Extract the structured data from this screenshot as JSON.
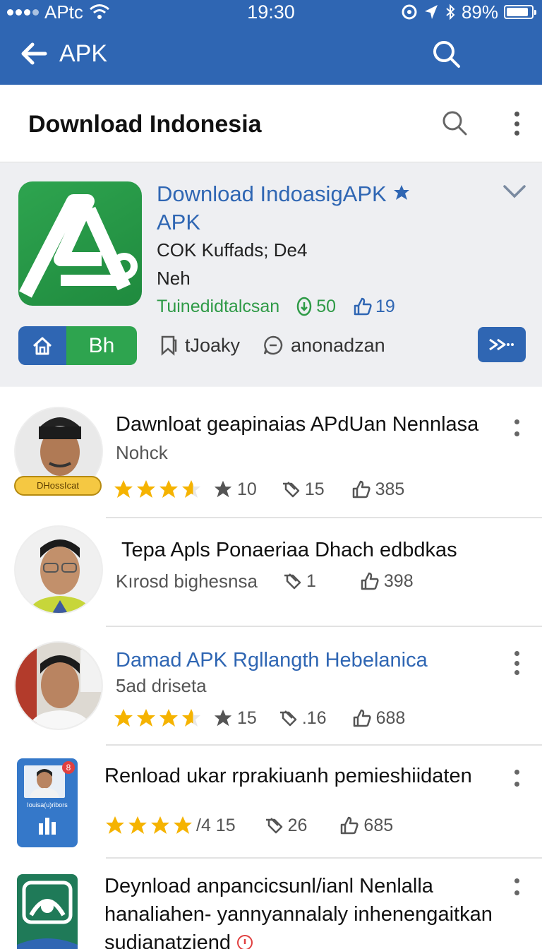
{
  "status_bar": {
    "carrier": "APtc",
    "time": "19:30",
    "battery": "89%"
  },
  "app_bar": {
    "title": "APK"
  },
  "sub_header": {
    "title": "Download Indonesia"
  },
  "featured": {
    "name_line1": "Download IndoasigAPK",
    "name_line2": "APK",
    "line3": "COK Kuffads; De4",
    "line4": "Neh",
    "meta_label": "Tuinedidtalcsan",
    "downloads": "50",
    "likes": "19",
    "pill_label": "Bh",
    "action1": "tJoaky",
    "action2": "anonadzan"
  },
  "list": [
    {
      "title": "Dawnloat geapinaias APdUan Nennlasa",
      "subtitle": "Nohck",
      "rating": "10",
      "shares": "15",
      "likes": "385",
      "badge": "DHossIcat"
    },
    {
      "title": "Tepa Apls Ponaeriaa Dhach edbdkas",
      "subtitle": "Kırosd bighesnsa",
      "shares": "1",
      "likes": "398"
    },
    {
      "title": "Damad APK Rgllangth Hebelanica",
      "subtitle": "5ad driseta",
      "rating": "15",
      "shares": ".16",
      "likes": "688"
    },
    {
      "title": "Renload ukar rprakiuanh pemieshiidaten",
      "thumb_caption": "Iouisa(u)ribors",
      "rating": "/4 15",
      "shares": "26",
      "likes": "685"
    },
    {
      "title_line1": "Deynload anpancicsunl/ianl Nenlalla",
      "title_line2": "hanaliahen- yannyannalaly inhenengaitkan",
      "title_line3": "sudianatziend"
    }
  ],
  "colors": {
    "primary": "#2f66b3",
    "green": "#2ea44f",
    "star": "#f5b301"
  }
}
